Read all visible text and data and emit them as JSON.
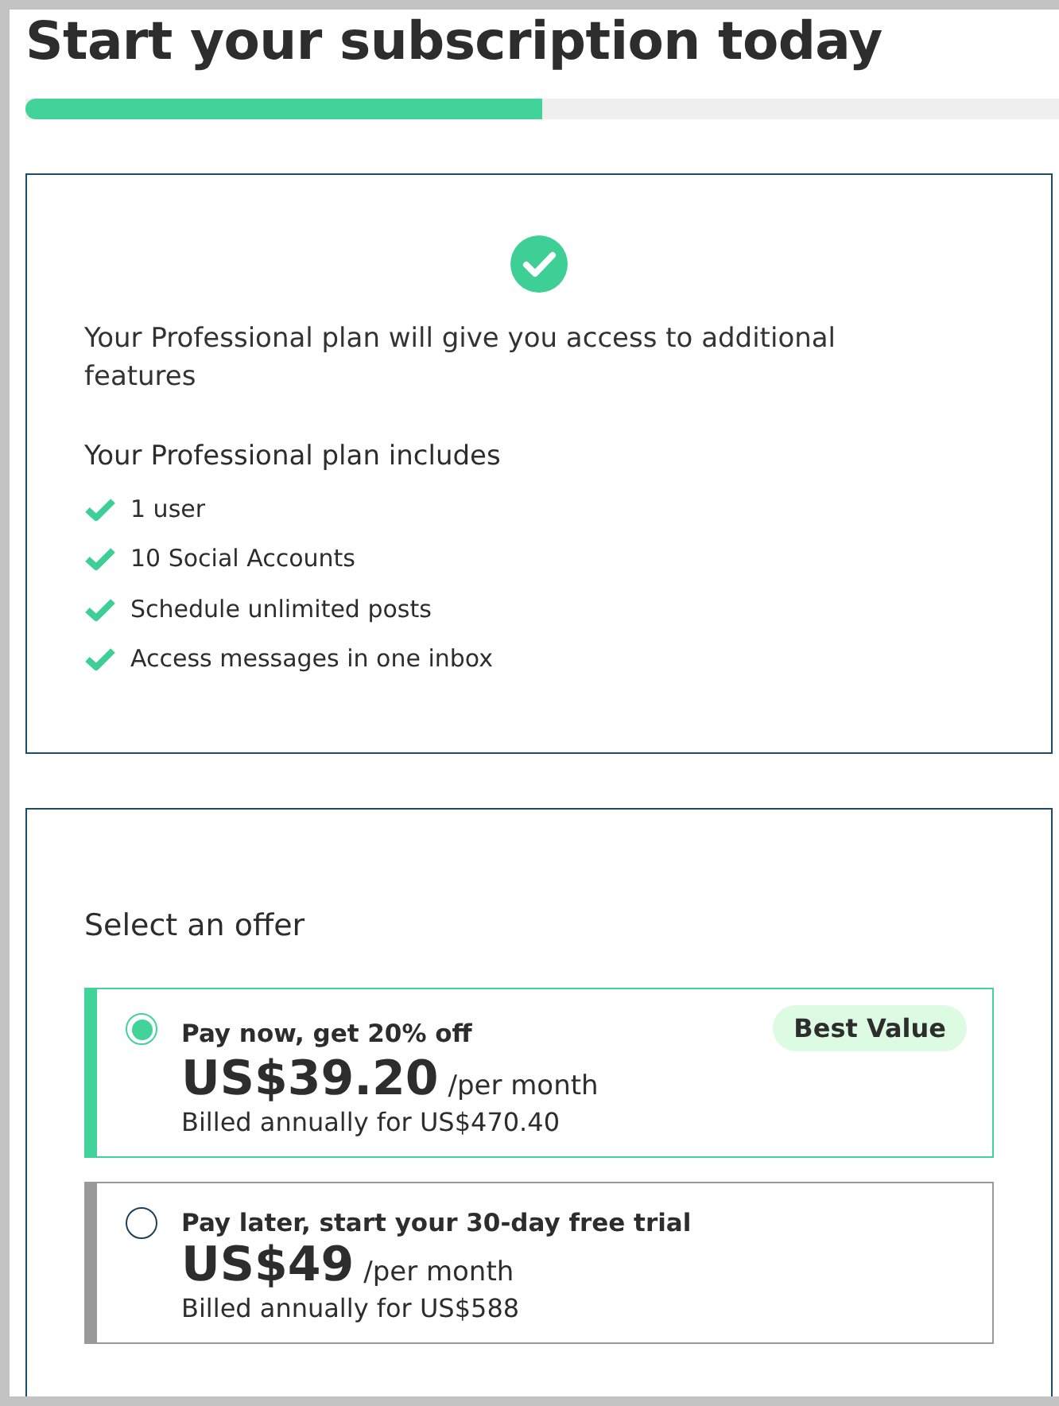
{
  "title": "Start your subscription today",
  "progress": {
    "level": 0.5
  },
  "plan_card": {
    "message": "Your Professional plan will give you access to additional features",
    "includes_heading": "Your Professional plan includes",
    "features": [
      "1 user",
      "10 Social Accounts",
      "Schedule unlimited posts",
      "Access messages in one inbox"
    ]
  },
  "offer_card": {
    "heading": "Select an offer",
    "offers": [
      {
        "title": "Pay now, get 20% off",
        "badge": "Best Value",
        "price": "US$39.20",
        "period": "/per month",
        "billing": "Billed annually for US$470.40",
        "selected": true
      },
      {
        "title": "Pay later, start your 30-day free trial",
        "price": "US$49",
        "period": "/per month",
        "billing": "Billed annually for US$588",
        "selected": false
      }
    ]
  }
}
